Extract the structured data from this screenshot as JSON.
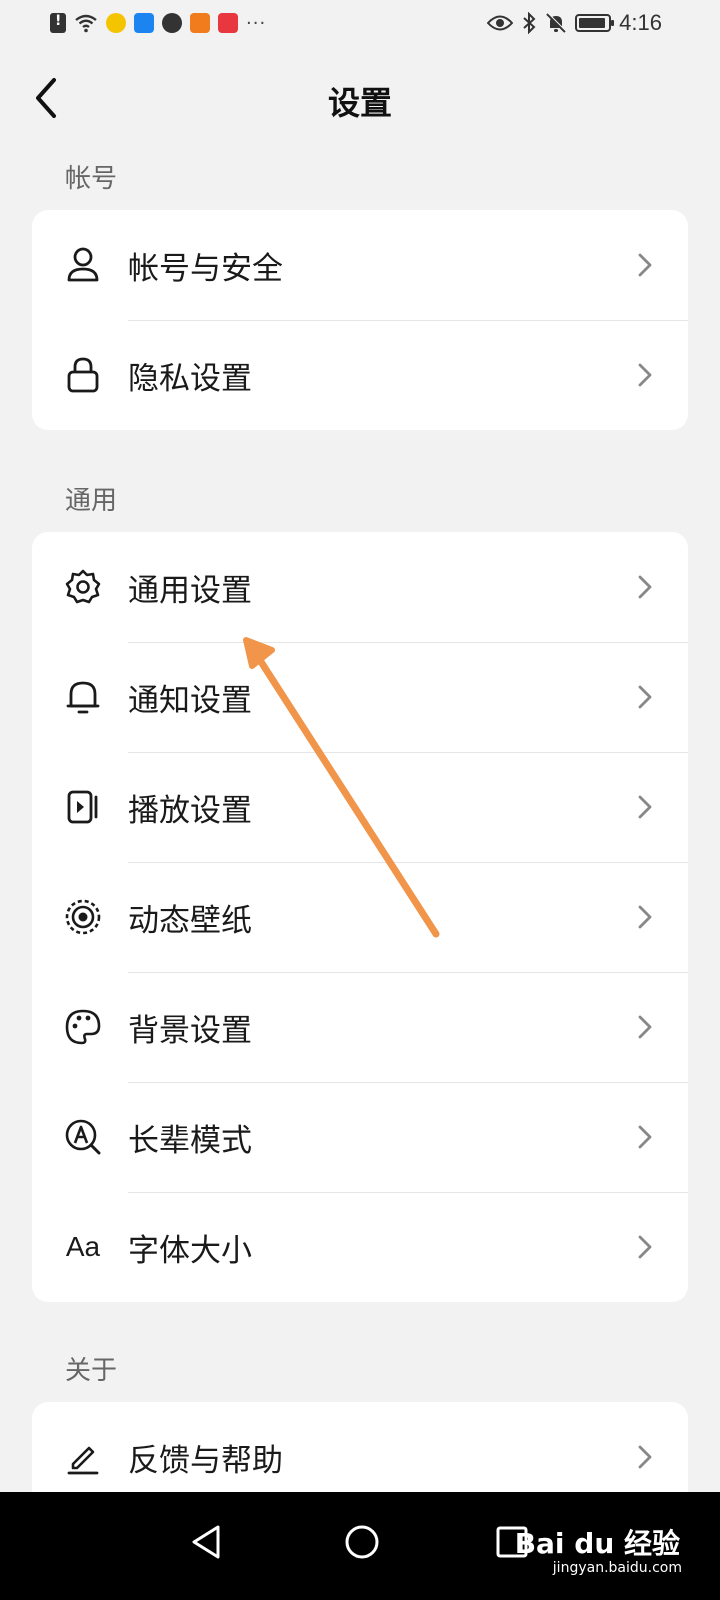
{
  "status_bar": {
    "time": "4:16",
    "dots": "···"
  },
  "header": {
    "title": "设置"
  },
  "sections": [
    {
      "label": "帐号",
      "items": [
        {
          "label": "帐号与安全",
          "icon": "user-icon"
        },
        {
          "label": "隐私设置",
          "icon": "lock-icon"
        }
      ]
    },
    {
      "label": "通用",
      "items": [
        {
          "label": "通用设置",
          "icon": "gear-icon"
        },
        {
          "label": "通知设置",
          "icon": "bell-icon"
        },
        {
          "label": "播放设置",
          "icon": "play-icon"
        },
        {
          "label": "动态壁纸",
          "icon": "wallpaper-icon"
        },
        {
          "label": "背景设置",
          "icon": "palette-icon"
        },
        {
          "label": "长辈模式",
          "icon": "elder-mode-icon"
        },
        {
          "label": "字体大小",
          "icon": "font-size-icon",
          "icon_text": "Aa"
        }
      ]
    },
    {
      "label": "关于",
      "items": [
        {
          "label": "反馈与帮助",
          "icon": "edit-icon"
        }
      ]
    }
  ],
  "watermark": {
    "brand": "Bai du 经验",
    "url": "jingyan.baidu.com"
  },
  "colors": {
    "annotation_arrow": "#f0954a",
    "background": "#f2f2f2",
    "card": "#ffffff"
  }
}
